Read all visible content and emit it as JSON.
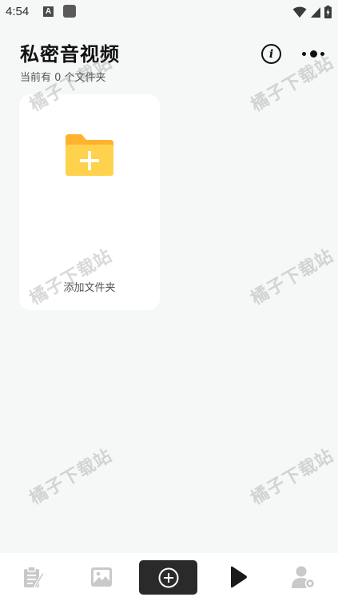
{
  "status_bar": {
    "time": "4:54",
    "notification_letter": "A"
  },
  "header": {
    "title": "私密音视频",
    "folder_count_text": "当前有 0 个文件夹",
    "info_icon_glyph": "i"
  },
  "folder_card": {
    "label": "添加文件夹"
  },
  "watermark_text": "橘子下载站",
  "bottom_nav": {
    "items": [
      {
        "icon": "notes-icon"
      },
      {
        "icon": "image-icon"
      },
      {
        "icon": "add-circle-icon"
      },
      {
        "icon": "play-icon"
      },
      {
        "icon": "user-settings-icon"
      }
    ]
  },
  "colors": {
    "background": "#f6f7f7",
    "folder_yellow": "#ffd24d",
    "folder_tab": "#ffb22e",
    "nav_center": "#2a2a2a"
  }
}
